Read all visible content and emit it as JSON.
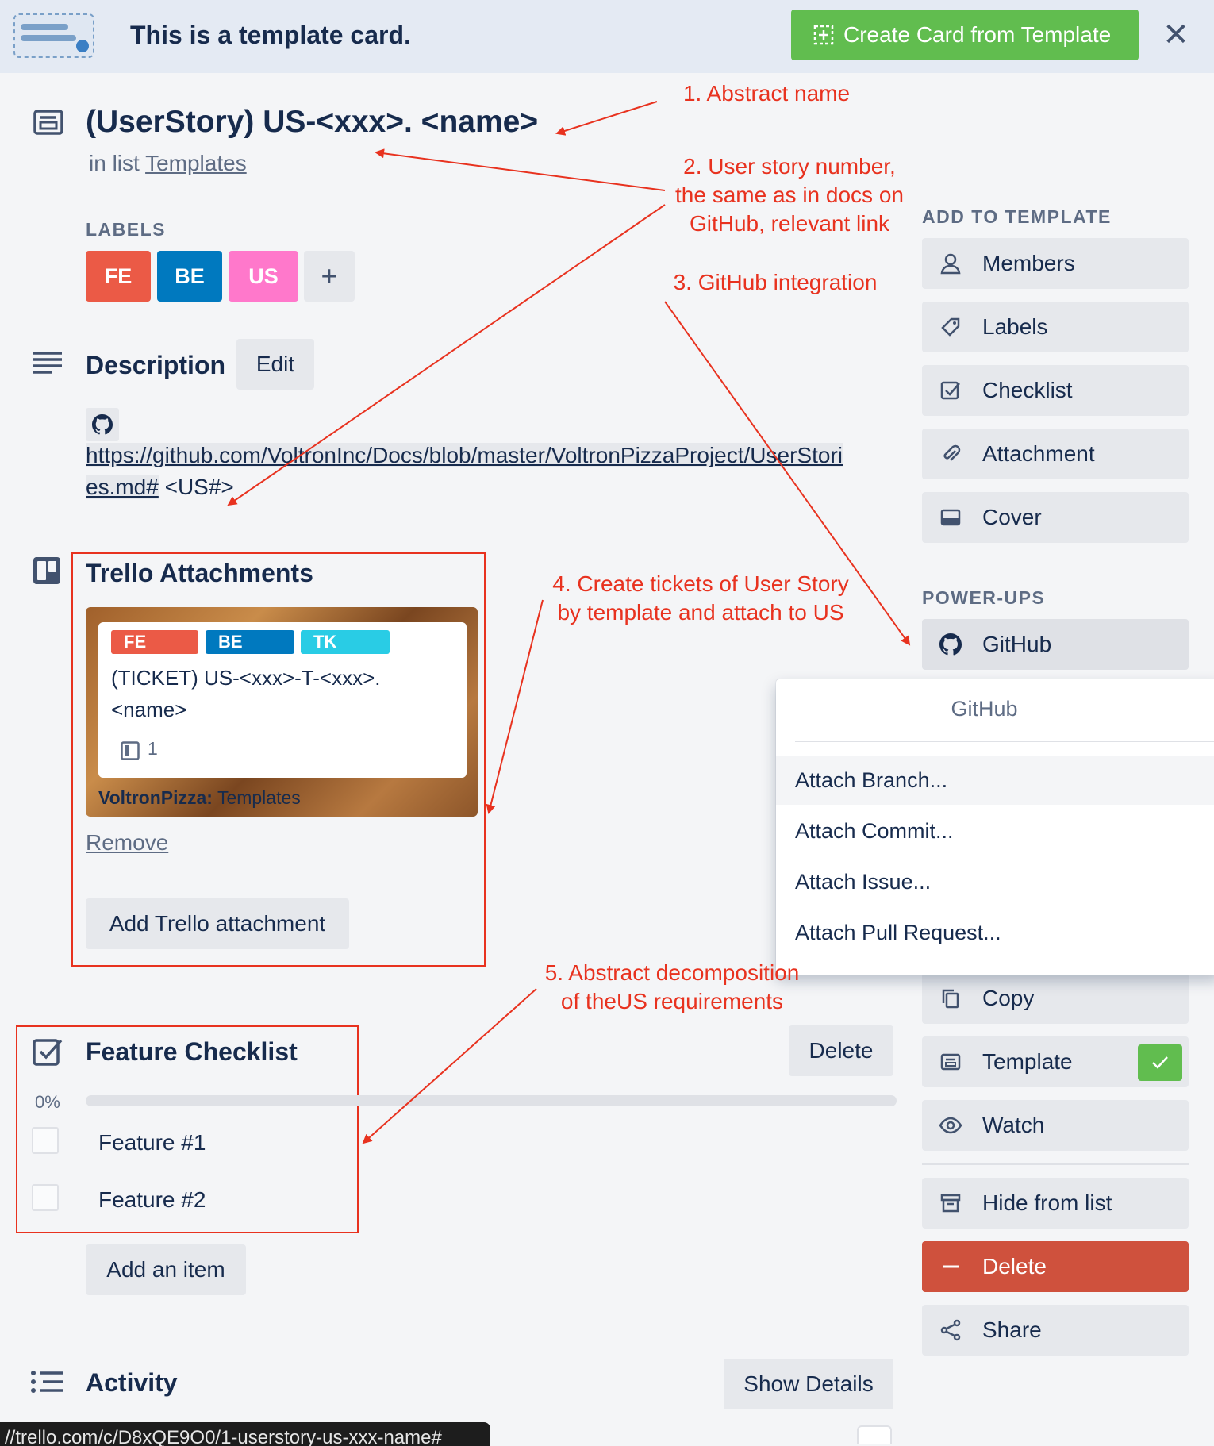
{
  "banner": {
    "title": "This is a template card.",
    "create_button": "Create Card from Template"
  },
  "card": {
    "title": "(UserStory) US-<xxx>. <name>",
    "in_list_prefix": "in list ",
    "list_name": "Templates"
  },
  "labels": {
    "heading": "LABELS",
    "items": [
      {
        "text": "FE",
        "color": "#eb5a46"
      },
      {
        "text": "BE",
        "color": "#0079bf"
      },
      {
        "text": "US",
        "color": "#ff78cb"
      }
    ],
    "add": "+"
  },
  "description": {
    "heading": "Description",
    "edit": "Edit",
    "link_line1": "https://github.com/VoltronInc/Docs/blob/master/VoltronPizzaProject/UserStori",
    "link_line2": "es.md#",
    "suffix": " <US#>"
  },
  "trello_attachments": {
    "heading": "Trello Attachments",
    "card_labels": [
      {
        "text": "FE",
        "color": "#eb5a46"
      },
      {
        "text": "BE",
        "color": "#0079bf"
      },
      {
        "text": "TK",
        "color": "#29cce5"
      }
    ],
    "card_title": "(TICKET) US-<xxx>-T-<xxx>. <name>",
    "attachment_count": "1",
    "board_name": "VoltronPizza:",
    "board_list": " Templates",
    "remove": "Remove",
    "add_button": "Add Trello attachment"
  },
  "checklist": {
    "heading": "Feature Checklist",
    "delete": "Delete",
    "percent": "0%",
    "progress": 0,
    "items": [
      "Feature #1",
      "Feature #2"
    ],
    "add_item": "Add an item"
  },
  "activity": {
    "heading": "Activity",
    "show_details": "Show Details"
  },
  "sidebar": {
    "add_heading": "ADD TO TEMPLATE",
    "add_items": [
      "Members",
      "Labels",
      "Checklist",
      "Attachment",
      "Cover"
    ],
    "powerups_heading": "POWER-UPS",
    "github": "GitHub",
    "actions": [
      "Copy",
      "Template",
      "Watch"
    ],
    "hide": "Hide from list",
    "delete": "Delete",
    "share": "Share"
  },
  "github_popover": {
    "title": "GitHub",
    "items": [
      "Attach Branch...",
      "Attach Commit...",
      "Attach Issue...",
      "Attach Pull Request..."
    ]
  },
  "annotations": {
    "a1": "1. Abstract name",
    "a2_line1": "2. User story number,",
    "a2_line2": "the same as in docs on",
    "a2_line3": "GitHub, relevant link",
    "a3": "3. GitHub integration",
    "a4_line1": "4. Create tickets of User Story",
    "a4_line2": "by template and attach to US",
    "a5_line1": "5. Abstract decomposition",
    "a5_line2": "of theUS requirements"
  },
  "status_bar_url": "//trello.com/c/D8xQE9O0/1-userstory-us-xxx-name#"
}
